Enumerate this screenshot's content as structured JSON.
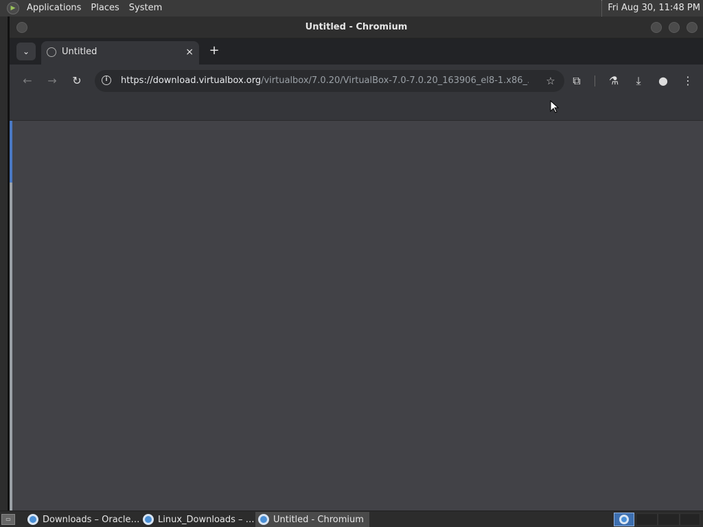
{
  "top_panel": {
    "menus": [
      "Applications",
      "Places",
      "System"
    ],
    "clock": "Fri Aug 30, 11:48 PM"
  },
  "window": {
    "title": "Untitled - Chromium"
  },
  "tabs": [
    {
      "label": "Untitled",
      "close_icon": "×"
    }
  ],
  "new_tab_icon": "+",
  "omnibox": {
    "host": "https://download.virtualbox.org",
    "path": "/virtualbox/7.0.20/VirtualBox-7.0-7.0.20_163906_el8-1.x86_..."
  },
  "icons": {
    "back": "←",
    "forward": "→",
    "reload": "↻",
    "bookmark": "☆",
    "extensions": "⧉",
    "labs": "⚗",
    "download": "⤓",
    "profile": "●",
    "menu": "⋮",
    "tab_search": "⌄"
  },
  "taskbar": {
    "tasks": [
      {
        "label": "Downloads – Oracle…"
      },
      {
        "label": "Linux_Downloads – …"
      },
      {
        "label": "Untitled - Chromium",
        "active": true
      }
    ]
  },
  "colors": {
    "content_bg": "#424247",
    "toolbar_bg": "#35363a",
    "tabstrip_bg": "#222326"
  }
}
